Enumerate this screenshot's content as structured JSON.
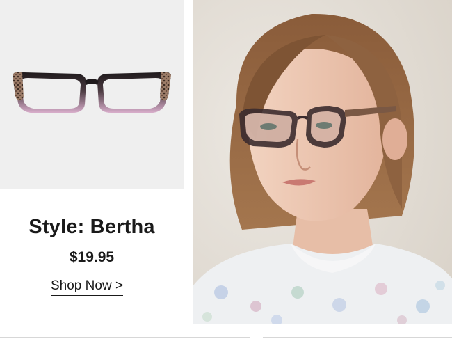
{
  "product": {
    "style_label": "Style: Bertha",
    "price": "$19.95",
    "shop_label": "Shop Now >"
  },
  "colors": {
    "product_bg": "#efefef",
    "frame_dark": "#1f1a1c",
    "frame_pink": "#d4a9c3",
    "leopard": "#8a6a58",
    "text": "#1a1a1a"
  }
}
